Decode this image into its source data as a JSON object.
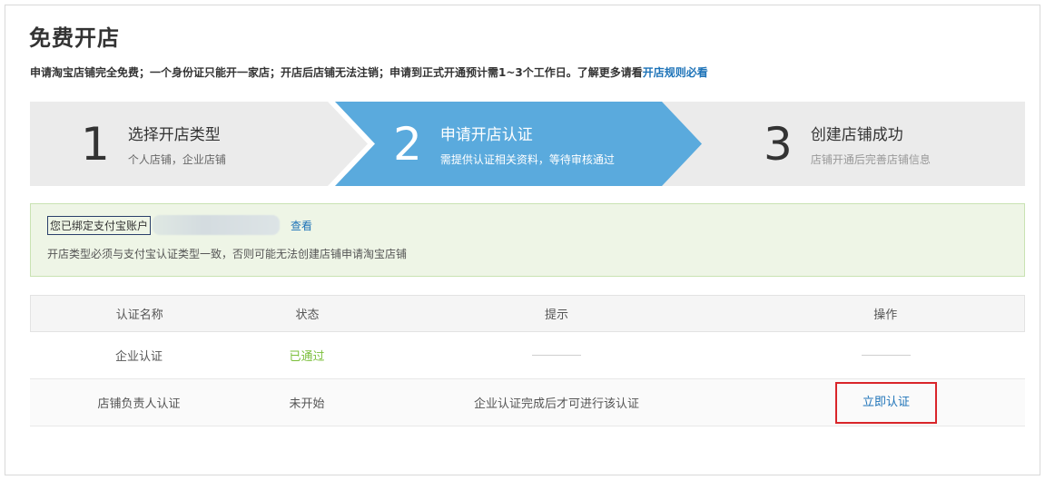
{
  "page": {
    "title": "免费开店",
    "intro_text": "申请淘宝店铺完全免费；一个身份证只能开一家店；开店后店铺无法注销；申请到正式开通预计需1~3个工作日。了解更多请看",
    "intro_link": "开店规则必看"
  },
  "steps": [
    {
      "number": "1",
      "title": "选择开店类型",
      "subtitle": "个人店铺，企业店铺",
      "state": "done"
    },
    {
      "number": "2",
      "title": "申请开店认证",
      "subtitle": "需提供认证相关资料，等待审核通过",
      "state": "active"
    },
    {
      "number": "3",
      "title": "创建店铺成功",
      "subtitle": "店铺开通后完善店铺信息",
      "state": "pending"
    }
  ],
  "notice": {
    "account_label": "您已绑定支付宝账户",
    "view_link": "查看",
    "warning": "开店类型必须与支付宝认证类型一致，否则可能无法创建店铺申请淘宝店铺"
  },
  "table": {
    "headers": [
      "认证名称",
      "状态",
      "提示",
      "操作"
    ],
    "rows": [
      {
        "name": "企业认证",
        "status": "已通过",
        "tip": "",
        "action": ""
      },
      {
        "name": "店铺负责人认证",
        "status": "未开始",
        "tip": "企业认证完成后才可进行该认证",
        "action": "立即认证"
      }
    ]
  },
  "colors": {
    "active_step": "#5aaadd",
    "link": "#1d73b8",
    "success": "#7bbf3b",
    "highlight_border": "#d9252a",
    "notice_bg": "#eef5e6"
  }
}
